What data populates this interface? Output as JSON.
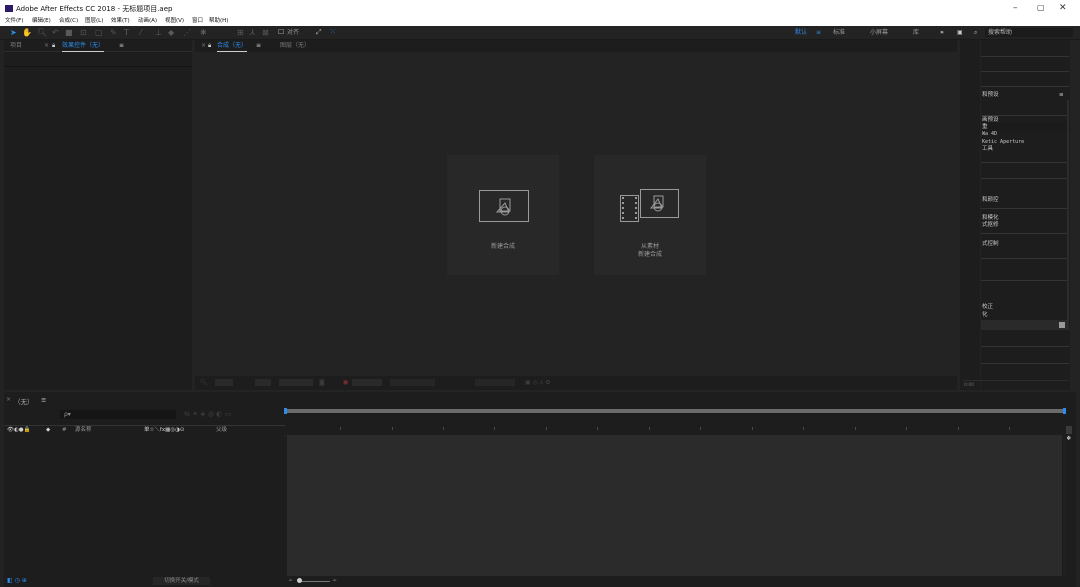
{
  "window": {
    "title": "Adobe After Effects CC 2018 - 无标题项目.aep",
    "controls": {
      "minimize": "–",
      "maximize": "▢",
      "close": "✕"
    }
  },
  "menu": [
    "文件(F)",
    "编辑(E)",
    "合成(C)",
    "图层(L)",
    "效果(T)",
    "动画(A)",
    "视图(V)",
    "窗口",
    "帮助(H)"
  ],
  "toolbar": {
    "align_label": "对齐",
    "workspaces": [
      "默认",
      "标准",
      "小屏幕",
      "库"
    ],
    "more": "»",
    "search_placeholder": "搜索帮助"
  },
  "project_panel": {
    "tab_project": "项目",
    "tab_effects": "效果控件（无）",
    "menu_icon": "≡"
  },
  "composition_panel": {
    "tab_comp": "合成（无）",
    "tab_layer": "图层（无）",
    "menu_icon": "≡",
    "new_comp_label": "新建合成",
    "from_footage_label": "从素材",
    "from_footage_label2": "新建合成"
  },
  "right_panel": {
    "presets_title": "和预设",
    "menu_icon": "≡",
    "items": [
      "画预设",
      "重",
      "Wa 4D",
      "Ketic Aperture",
      "工具"
    ],
    "items2": [
      "和颜控",
      "和模化",
      "式抠修",
      "式控制"
    ],
    "items3": [
      "校正",
      "化"
    ],
    "bottom": "0:00"
  },
  "timeline": {
    "tab": "（无）",
    "menu_icon": "≡",
    "search_placeholder": "ρ▾",
    "column_icons": "👁◐●🔒",
    "col_num": "#",
    "col_source": "源名称",
    "col_switches": "单☆＼fx▦◎◑⊙",
    "col_parent": "父级",
    "footer_toggle": "切换开关/模式"
  },
  "colors": {
    "accent": "#2d8ceb",
    "panel_bg": "#1d1d1d",
    "app_bg": "#232323"
  }
}
